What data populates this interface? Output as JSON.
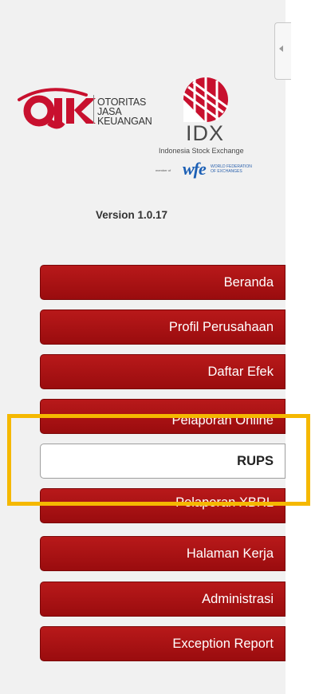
{
  "ojk": {
    "line1": "OTORITAS",
    "line2": "JASA",
    "line3": "KEUANGAN"
  },
  "idx": {
    "wordmark": "IDX",
    "subtitle": "Indonesia Stock Exchange",
    "wfe_prefix": "member of",
    "wfe_mark": "wfe",
    "wfe_name_1": "WORLD FEDERATION",
    "wfe_name_2": "OF EXCHANGES"
  },
  "version": "Version 1.0.17",
  "menu": [
    {
      "label": "Beranda"
    },
    {
      "label": "Profil Perusahaan"
    },
    {
      "label": "Daftar Efek"
    },
    {
      "label": "Pelaporan Online"
    },
    {
      "label": "RUPS"
    },
    {
      "label": "Pelaporan XBRL"
    },
    {
      "label": "Halaman Kerja"
    },
    {
      "label": "Administrasi"
    },
    {
      "label": "Exception Report"
    }
  ],
  "active_item": "RUPS",
  "colors": {
    "menu_red": "#b8191a",
    "highlight": "#f5b800",
    "ojk_red": "#c8102e"
  }
}
